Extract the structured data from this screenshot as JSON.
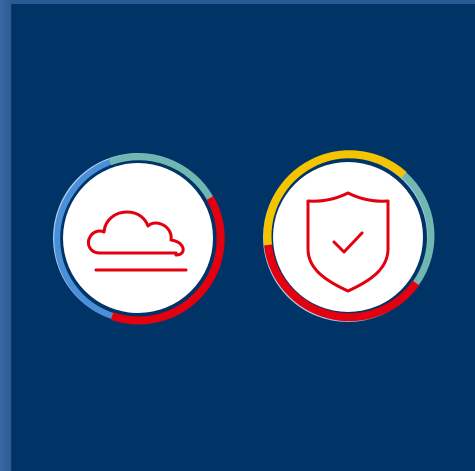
{
  "badges": [
    {
      "name": "cloud-badge",
      "icon": "cloud-icon",
      "ring_colors": [
        "#6fb7b0",
        "#e3000f",
        "#4a90d9",
        "#a9cdee"
      ]
    },
    {
      "name": "security-badge",
      "icon": "shield-check-icon",
      "ring_colors": [
        "#f5c400",
        "#6fb7b0",
        "#e3000f",
        "#a9cdee"
      ]
    }
  ],
  "colors": {
    "background": "#003366",
    "icon_stroke": "#e3000f",
    "badge_fill": "#ffffff"
  }
}
